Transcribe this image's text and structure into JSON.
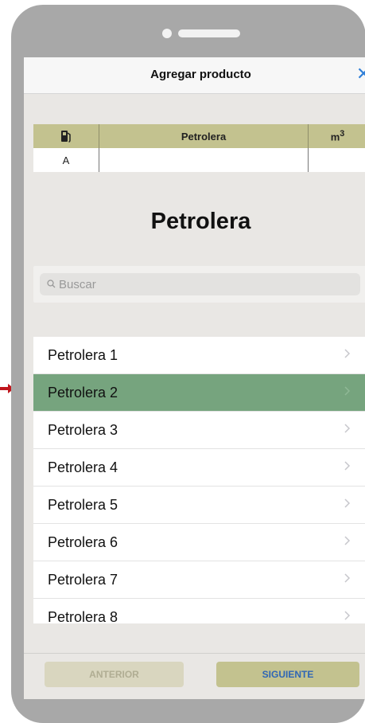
{
  "navbar": {
    "title": "Agregar producto",
    "close": "✕"
  },
  "summary_table": {
    "headers": [
      "",
      "Petrolera",
      "m³"
    ],
    "rows": [
      [
        "A",
        "",
        ""
      ]
    ]
  },
  "section": {
    "title": "Petrolera"
  },
  "search": {
    "placeholder": "Buscar"
  },
  "list": {
    "items": [
      "Petrolera 1",
      "Petrolera 2",
      "Petrolera 3",
      "Petrolera 4",
      "Petrolera 5",
      "Petrolera 6",
      "Petrolera 7",
      "Petrolera 8"
    ],
    "selected_index": 1
  },
  "buttons": {
    "previous": "ANTERIOR",
    "next": "SIGUIENTE"
  },
  "colors": {
    "selected_row": "#76a47e",
    "header_fill": "#c3c28f",
    "accent_blue": "#2f7fd8"
  }
}
